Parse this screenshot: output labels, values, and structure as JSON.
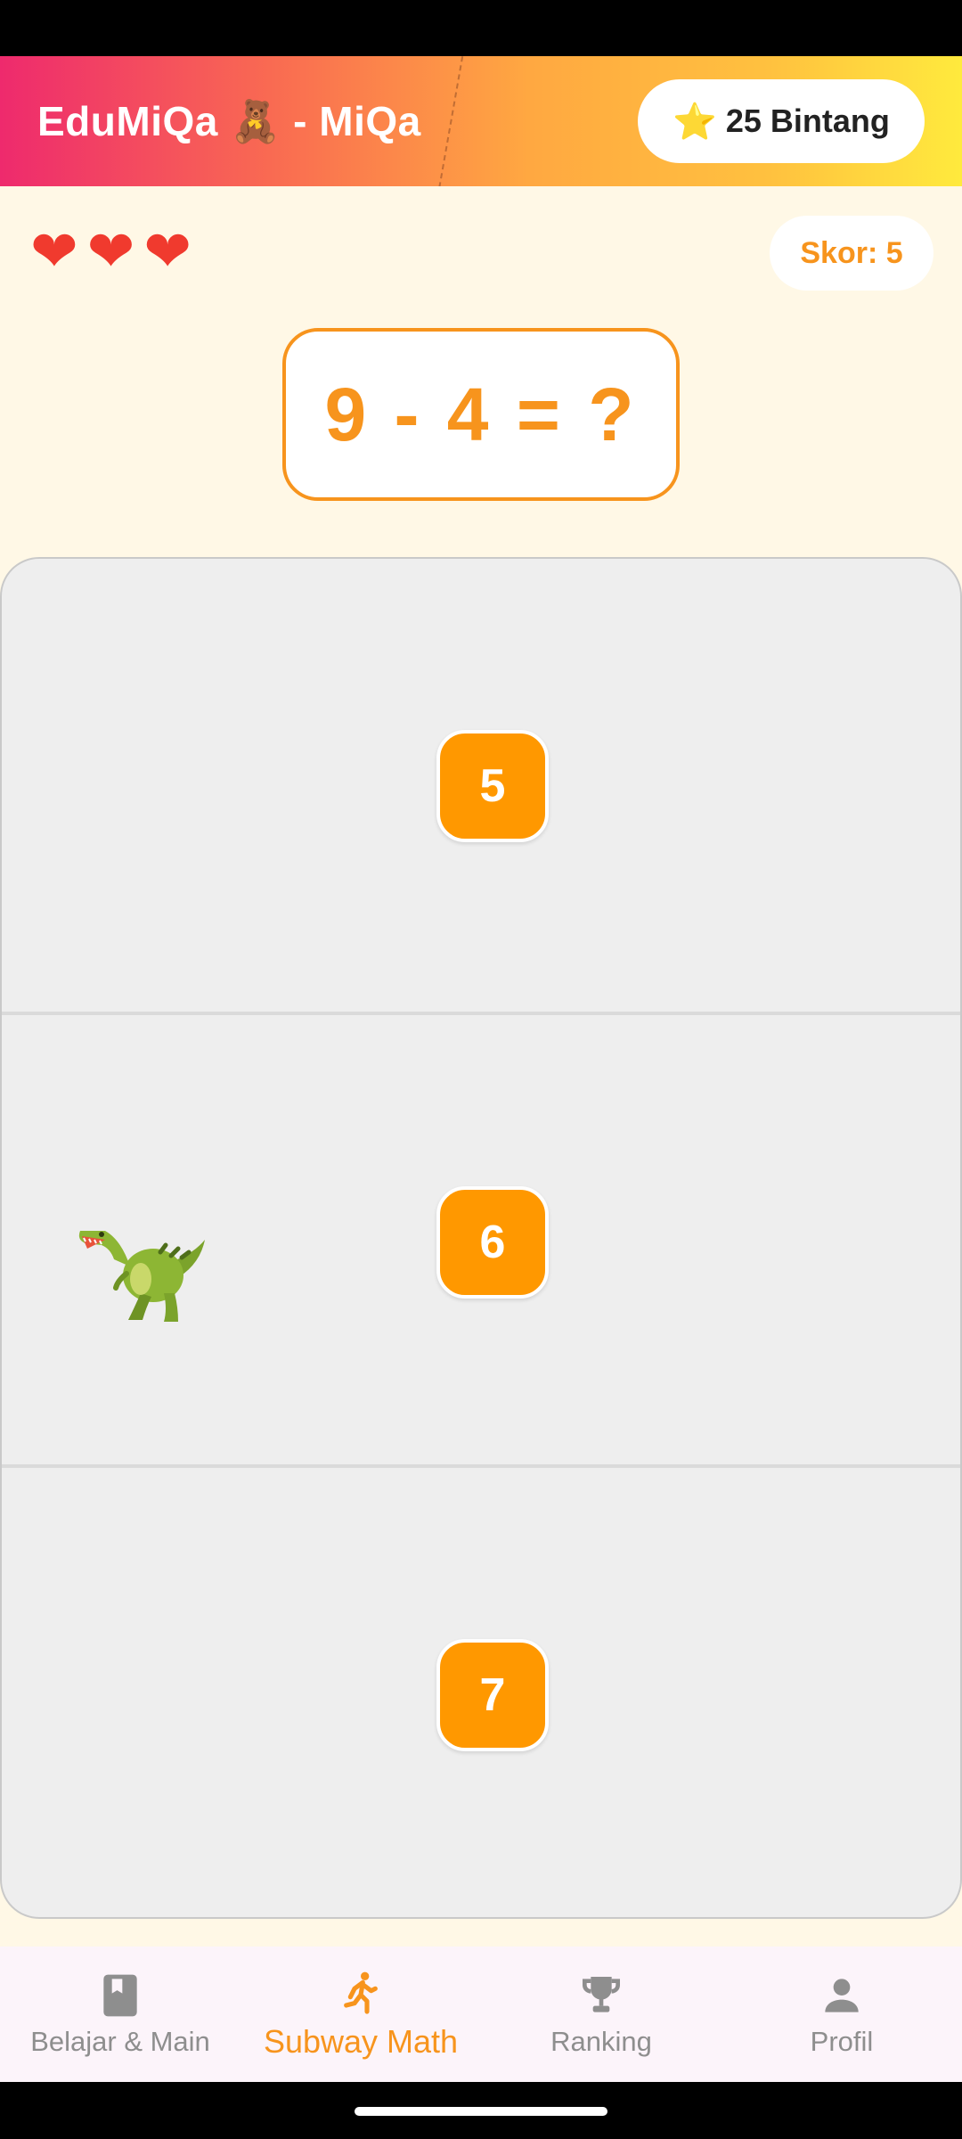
{
  "app_bar": {
    "title": "EduMiQa 🧸 - MiQa",
    "stars_icon": "⭐",
    "stars_label": "25 Bintang"
  },
  "status": {
    "lives": 3,
    "heart_glyph": "❤",
    "score_label": "Skor: 5"
  },
  "question": {
    "text": "9 - 4 = ?"
  },
  "lanes": [
    {
      "answer": "5"
    },
    {
      "answer": "6"
    },
    {
      "answer": "7"
    }
  ],
  "player": {
    "icon": "t-rex-icon",
    "lane": 2
  },
  "bottom_nav": {
    "items": [
      {
        "label": "Belajar & Main",
        "icon": "book-icon",
        "active": false
      },
      {
        "label": "Subway Math",
        "icon": "runner-icon",
        "active": true
      },
      {
        "label": "Ranking",
        "icon": "trophy-icon",
        "active": false
      },
      {
        "label": "Profil",
        "icon": "person-icon",
        "active": false
      }
    ]
  },
  "colors": {
    "accent": "#F7941D",
    "answer_tile": "#FF9800",
    "heart": "#F03A2E",
    "background": "#FFF8E6",
    "nav_inactive": "#8E8E8E"
  }
}
